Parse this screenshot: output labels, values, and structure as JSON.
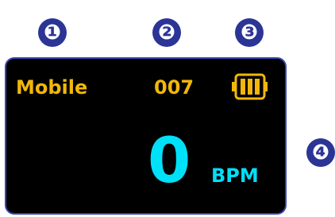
{
  "callouts": [
    "❶",
    "❷",
    "❸",
    "❹"
  ],
  "display": {
    "mode": "Mobile",
    "channel": "007",
    "battery": {
      "bars": 3,
      "max_bars": 3
    },
    "heart_rate": "0",
    "unit": "BPM"
  },
  "colors": {
    "callout": "#2b3596",
    "frame": "#3a46b4",
    "screen": "#000000",
    "status_text": "#f2b70a",
    "value_text": "#00e0f8"
  },
  "icons": {
    "battery": "battery-full-icon"
  }
}
